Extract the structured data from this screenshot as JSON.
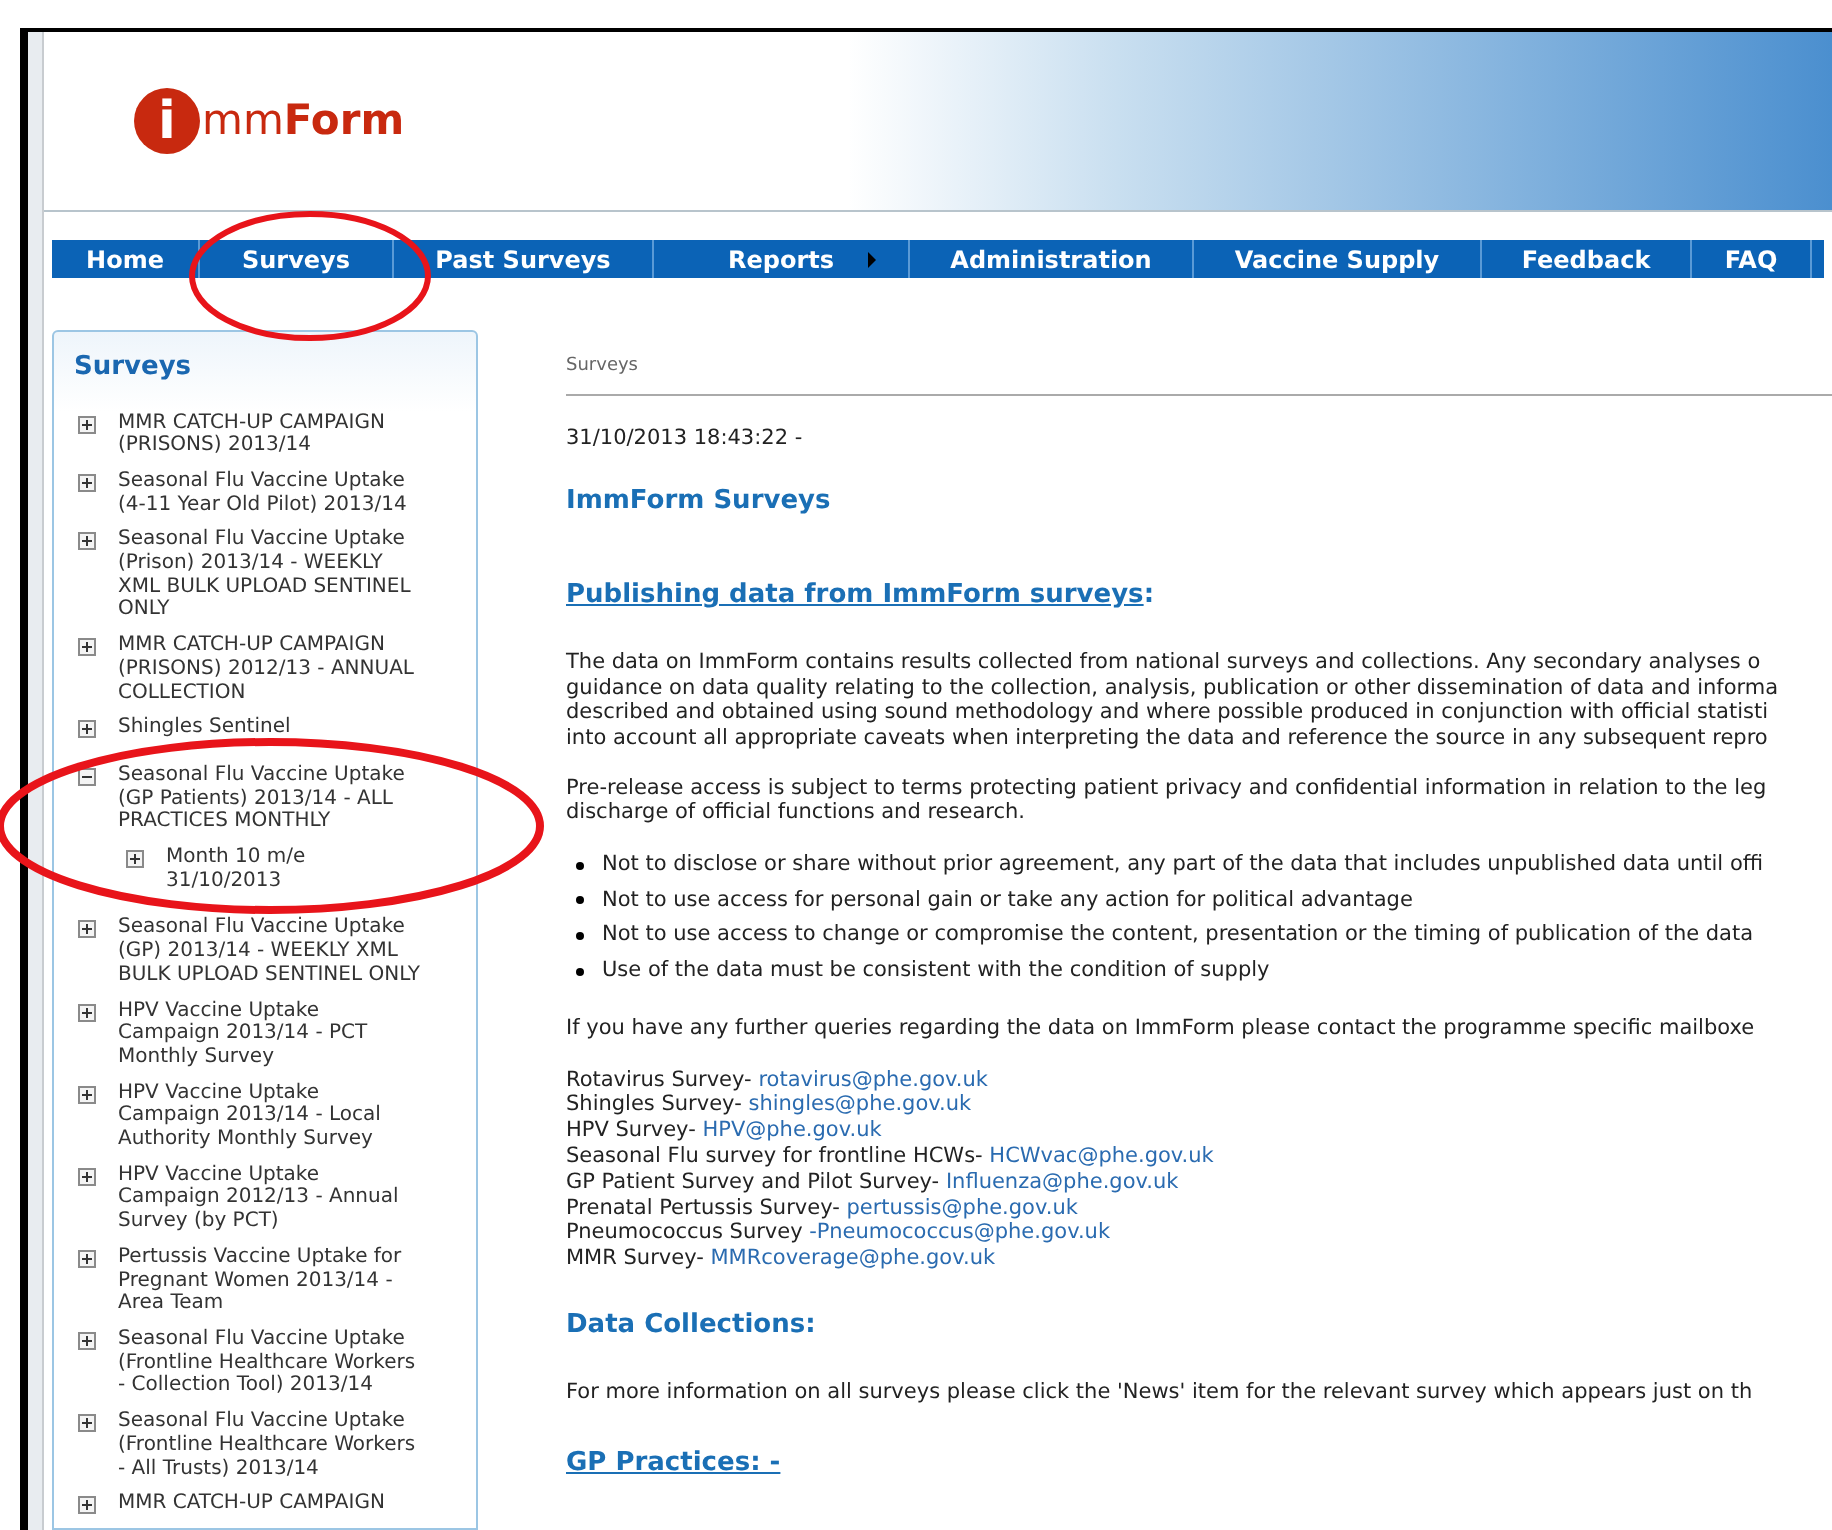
{
  "logo": {
    "initial": "i",
    "middle": "mm",
    "end": "Form"
  },
  "nav": [
    {
      "label": "Home",
      "has_submenu": false
    },
    {
      "label": "Surveys",
      "has_submenu": false
    },
    {
      "label": "Past Surveys",
      "has_submenu": false
    },
    {
      "label": "Reports",
      "has_submenu": true
    },
    {
      "label": "Administration",
      "has_submenu": false
    },
    {
      "label": "Vaccine Supply",
      "has_submenu": false
    },
    {
      "label": "Feedback",
      "has_submenu": false
    },
    {
      "label": "FAQ",
      "has_submenu": false
    }
  ],
  "sidebar": {
    "title": "Surveys",
    "items": [
      {
        "label": "MMR CATCH-UP CAMPAIGN (PRISONS) 2013/14",
        "expanded": false
      },
      {
        "label": "Seasonal Flu Vaccine Uptake (4-11 Year Old Pilot) 2013/14",
        "expanded": false
      },
      {
        "label": "Seasonal Flu Vaccine Uptake (Prison) 2013/14 - WEEKLY XML BULK UPLOAD SENTINEL ONLY",
        "expanded": false
      },
      {
        "label": "MMR CATCH-UP CAMPAIGN (PRISONS) 2012/13 - ANNUAL COLLECTION",
        "expanded": false
      },
      {
        "label": "Shingles Sentinel",
        "expanded": false
      },
      {
        "label": "Seasonal Flu Vaccine Uptake (GP Patients) 2013/14 - ALL PRACTICES MONTHLY",
        "expanded": true,
        "children": [
          {
            "label": "Month 10 m/e 31/10/2013",
            "expanded": false
          }
        ]
      },
      {
        "label": "Seasonal Flu Vaccine Uptake (GP) 2013/14 - WEEKLY XML BULK UPLOAD SENTINEL ONLY",
        "expanded": false
      },
      {
        "label": "HPV Vaccine Uptake Campaign 2013/14 - PCT Monthly Survey",
        "expanded": false
      },
      {
        "label": "HPV Vaccine Uptake Campaign 2013/14 - Local Authority Monthly Survey",
        "expanded": false
      },
      {
        "label": "HPV Vaccine Uptake Campaign 2012/13 - Annual Survey (by PCT)",
        "expanded": false
      },
      {
        "label": "Pertussis Vaccine Uptake for Pregnant Women 2013/14 - Area Team",
        "expanded": false
      },
      {
        "label": "Seasonal Flu Vaccine Uptake (Frontline Healthcare Workers - Collection Tool) 2013/14",
        "expanded": false
      },
      {
        "label": "Seasonal Flu Vaccine Uptake (Frontline Healthcare Workers - All Trusts) 2013/14",
        "expanded": false
      },
      {
        "label": "MMR CATCH-UP CAMPAIGN",
        "expanded": false
      }
    ]
  },
  "breadcrumb": "Surveys",
  "timestamp": "31/10/2013 18:43:22 -",
  "title": "ImmForm Surveys",
  "publishing": {
    "heading": "Publishing data from ImmForm surveys",
    "suffix": ":",
    "paragraph_1": [
      "The data on ImmForm contains results collected from national surveys and collections. Any secondary analyses o",
      "guidance on data quality relating to the collection, analysis, publication or other dissemination of data and informa",
      "described and obtained using sound methodology and where possible produced in conjunction with official statisti",
      "into account all appropriate caveats when interpreting the data and reference the source in any subsequent repro"
    ],
    "paragraph_2": [
      "Pre-release access is subject to terms protecting patient privacy and confidential information in relation to the leg",
      "discharge of official functions and research."
    ],
    "bullets": [
      "Not to disclose or share without prior agreement, any part of the data that includes unpublished data until offi",
      "Not to use access for personal gain or take any action for political advantage",
      "Not to use access to change or compromise the content, presentation or the timing of publication of the data",
      "Use of the data must be consistent with the condition of supply"
    ],
    "queries": "If you have any further queries regarding the data on ImmForm please contact the programme specific mailboxe",
    "contacts": [
      {
        "label": "Rotavirus Survey- ",
        "email": "rotavirus@phe.gov.uk"
      },
      {
        "label": "Shingles Survey- ",
        "email": "shingles@phe.gov.uk"
      },
      {
        "label": "HPV Survey- ",
        "email": "HPV@phe.gov.uk"
      },
      {
        "label": "Seasonal Flu survey for frontline HCWs- ",
        "email": "HCWvac@phe.gov.uk"
      },
      {
        "label": "GP Patient Survey and Pilot Survey- ",
        "email": "Influenza@phe.gov.uk"
      },
      {
        "label": "Prenatal Pertussis Survey- ",
        "email": "pertussis@phe.gov.uk"
      },
      {
        "label": "Pneumococcus Survey ",
        "email": "-Pneumococcus@phe.gov.uk"
      },
      {
        "label": "MMR Survey- ",
        "email": "MMRcoverage@phe.gov.uk"
      }
    ]
  },
  "data_collections": {
    "heading": "Data Collections:",
    "text": "For more information on all surveys please click the 'News' item for the relevant survey which appears just on th"
  },
  "gp_practices": {
    "heading": "GP Practices: -"
  }
}
